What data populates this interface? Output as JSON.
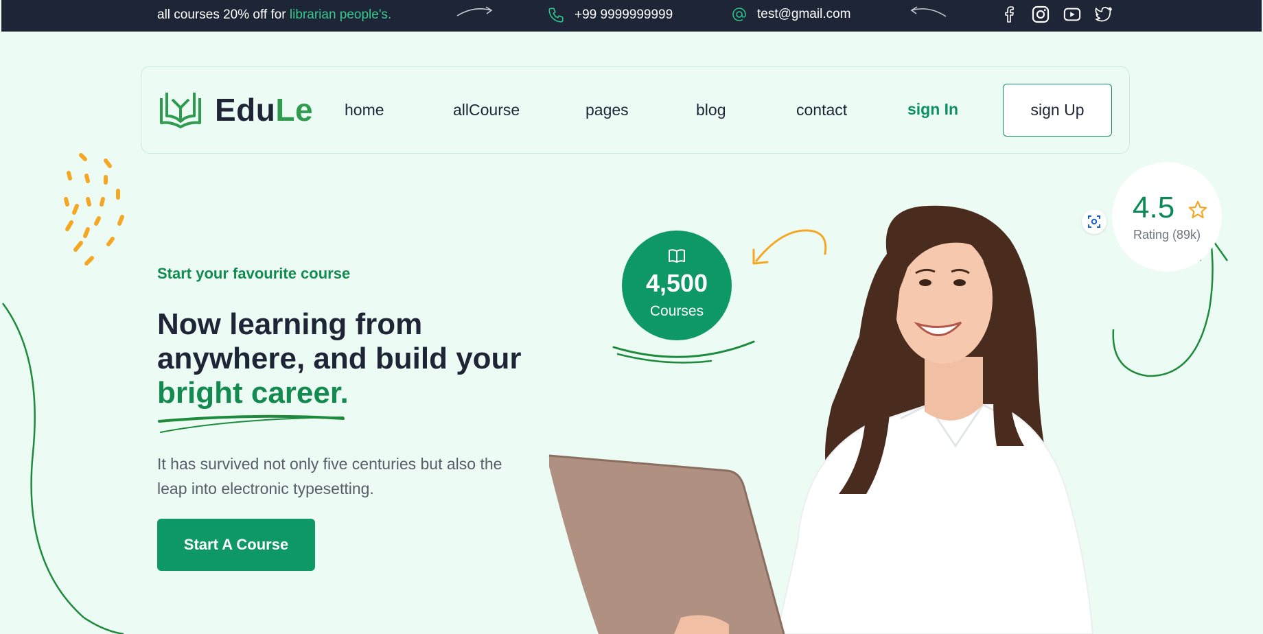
{
  "topbar": {
    "promo_prefix": "all courses 20% off for ",
    "promo_highlight": "librarian people's.",
    "phone": "+99 9999999999",
    "email": "test@gmail.com",
    "socials": [
      "facebook-icon",
      "instagram-icon",
      "youtube-icon",
      "twitter-icon"
    ]
  },
  "nav": {
    "logo_part1": "Edu",
    "logo_part2": "Le",
    "links": [
      "home",
      "allCourse",
      "pages",
      "blog",
      "contact"
    ],
    "signin": "sign In",
    "signup": "sign Up"
  },
  "hero": {
    "eyebrow": "Start your favourite course",
    "headline_line1": "Now learning from",
    "headline_line2": "anywhere, and build your",
    "headline_accent": "bright career.",
    "description": "It has survived not only five centuries but also the leap into electronic typesetting.",
    "cta": "Start A Course"
  },
  "stats": {
    "courses_value": "4,500",
    "courses_label": "Courses",
    "rating_value": "4.5",
    "rating_label": "Rating (89k)"
  },
  "colors": {
    "topbar_bg": "#1d2536",
    "page_bg": "#ecfbf3",
    "primary_green": "#0e9866",
    "accent_green": "#138a4f",
    "highlight_green": "#38c98c",
    "orange": "#f5a623"
  }
}
